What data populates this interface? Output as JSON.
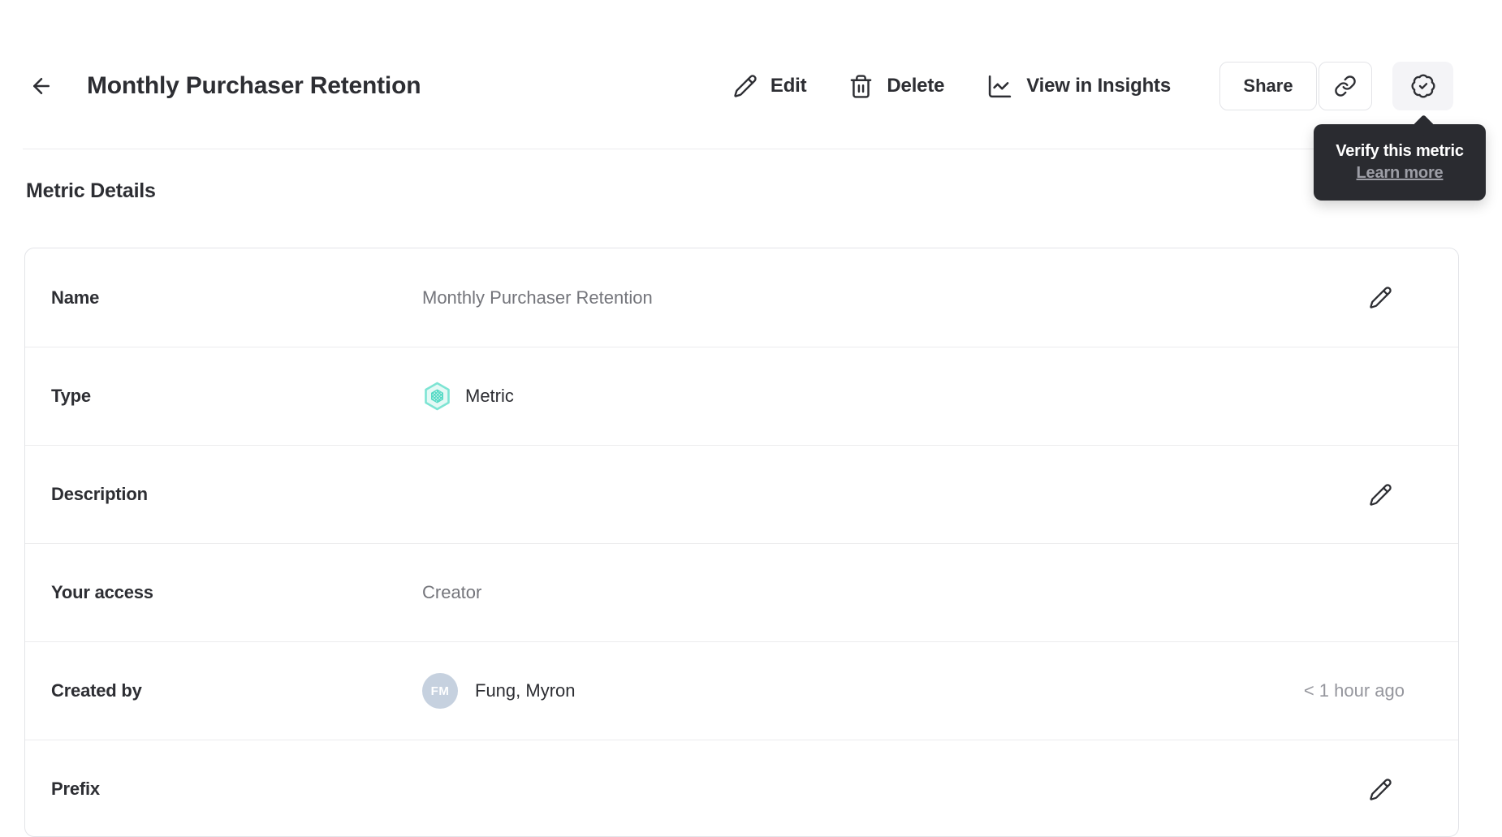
{
  "header": {
    "title": "Monthly Purchaser Retention",
    "back_icon": "arrow-left",
    "actions": [
      {
        "id": "edit",
        "label": "Edit",
        "icon": "pencil"
      },
      {
        "id": "delete",
        "label": "Delete",
        "icon": "trash"
      },
      {
        "id": "view-in-insights",
        "label": "View in Insights",
        "icon": "line-chart"
      }
    ],
    "share_label": "Share",
    "link_icon": "link",
    "verify_icon": "badge-check"
  },
  "tooltip": {
    "title": "Verify this metric",
    "link_label": "Learn more"
  },
  "section_title": "Metric Details",
  "details": {
    "rows": [
      {
        "label": "Name",
        "value": "Monthly Purchaser Retention",
        "editable": true
      },
      {
        "label": "Type",
        "value": "Metric",
        "icon": "metric-hexagon"
      },
      {
        "label": "Description",
        "value": "",
        "editable": true
      },
      {
        "label": "Your access",
        "value": "Creator"
      },
      {
        "label": "Created by",
        "value": "Fung, Myron",
        "avatar_initials": "FM",
        "meta": "< 1 hour ago"
      },
      {
        "label": "Prefix",
        "value": "",
        "editable": true
      }
    ]
  },
  "colors": {
    "ink": "#2d2e33",
    "value-gray": "#74757b",
    "meta-gray": "#95969d",
    "divider": "#ececee",
    "border": "#e3e4e8",
    "verify-bg": "#f4f4f7",
    "tooltip-bg": "#2a2b30",
    "tooltip-link": "#9d9ea6",
    "teal-border": "#7de4d3",
    "teal-fill": "#e4f9f5",
    "teal-inner": "#55dac5",
    "avatar-bg": "#c6d1df"
  }
}
